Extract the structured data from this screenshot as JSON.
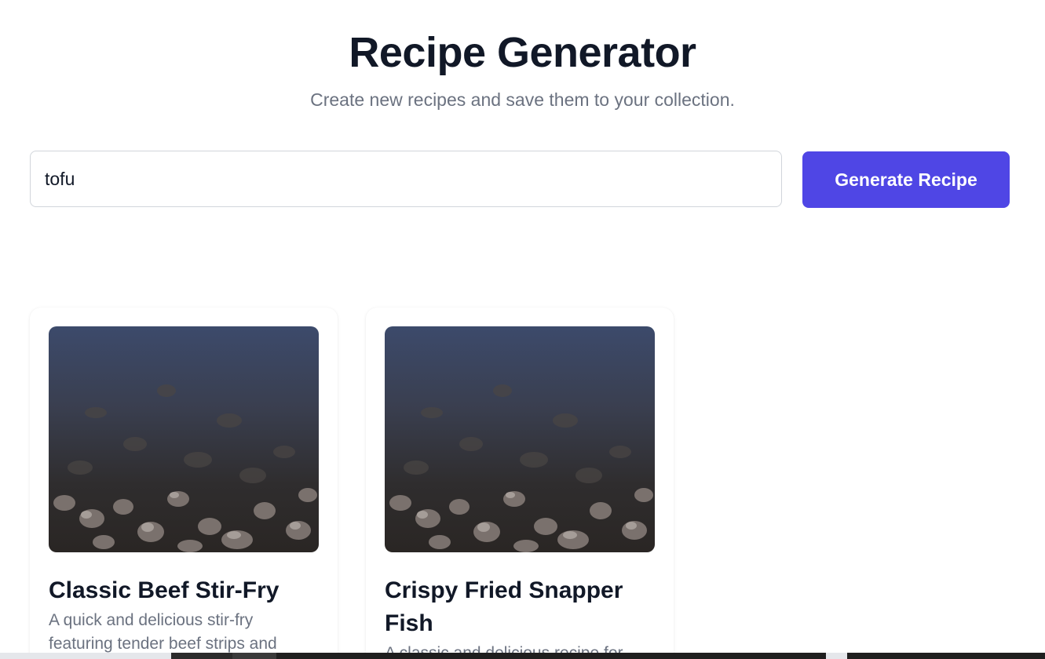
{
  "header": {
    "title": "Recipe Generator",
    "subtitle": "Create new recipes and save them to your collection."
  },
  "form": {
    "ingredient_value": "tofu",
    "generate_label": "Generate Recipe"
  },
  "recipes": [
    {
      "title": "Classic Beef Stir-Fry",
      "description": "A quick and delicious stir-fry featuring tender beef strips and",
      "image": "rocky-shore-photo"
    },
    {
      "title": "Crispy Fried Snapper Fish",
      "description": "A classic and delicious recipe for",
      "image": "rocky-shore-photo"
    }
  ],
  "colors": {
    "accent": "#4f46e5",
    "title": "#111827",
    "muted": "#6b7280",
    "border": "#d1d5db"
  }
}
